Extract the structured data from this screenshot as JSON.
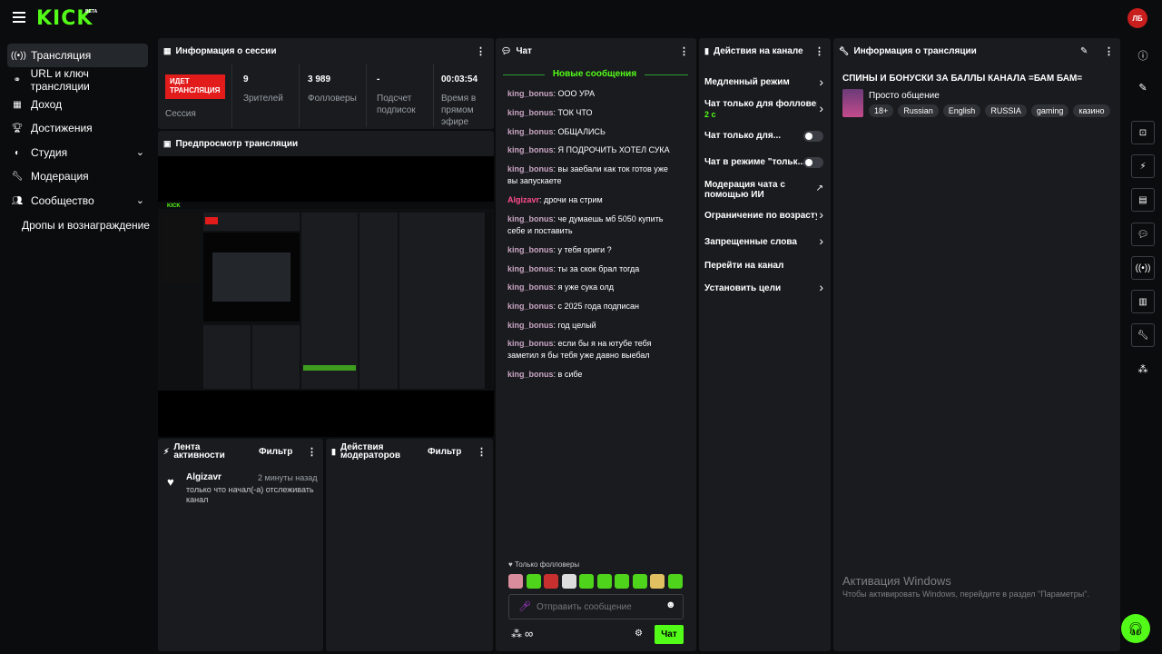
{
  "topbar": {
    "logo": "KICK",
    "beta": "BETA",
    "avatar": "ЛБ"
  },
  "sidebar": {
    "items": [
      {
        "label": "Трансляция",
        "icon": "broadcast-icon"
      },
      {
        "label": "URL и ключ трансляции",
        "icon": "link-icon"
      },
      {
        "label": "Доход",
        "icon": "chart-icon"
      },
      {
        "label": "Достижения",
        "icon": "trophy-icon"
      },
      {
        "label": "Студия",
        "icon": "palette-icon"
      },
      {
        "label": "Модерация",
        "icon": "wrench-icon"
      },
      {
        "label": "Сообщество",
        "icon": "people-icon"
      },
      {
        "label": "Дропы и вознаграждение",
        "icon": ""
      }
    ]
  },
  "session": {
    "title": "Информация о сессии",
    "live_badge": "ИДЕТ ТРАНСЛЯЦИЯ",
    "session_label": "Сессия",
    "stats": [
      {
        "value": "9",
        "label": "Зрителей"
      },
      {
        "value": "3 989",
        "label": "Фолловеры"
      },
      {
        "value": "-",
        "label": "Подсчет подписок"
      },
      {
        "value": "00:03:54",
        "label": "Время в прямом эфире"
      }
    ]
  },
  "preview": {
    "title": "Предпросмотр трансляции"
  },
  "activity": {
    "title": "Лента активности",
    "filter": "Фильтр",
    "items": [
      {
        "user": "Algizavr",
        "time": "2 минуты назад",
        "text": "только что начал(-а) отслеживать канал"
      }
    ]
  },
  "modactions": {
    "title": "Действия модераторов",
    "filter": "Фильтр"
  },
  "chat": {
    "title": "Чат",
    "new_messages": "Новые сообщения",
    "messages": [
      {
        "user": "king_bonus",
        "text": "ООО УРА"
      },
      {
        "user": "king_bonus",
        "text": "ТОК ЧТО"
      },
      {
        "user": "king_bonus",
        "text": "ОБЩАЛИСЬ"
      },
      {
        "user": "king_bonus",
        "text": "Я ПОДРОЧИТЬ ХОТЕЛ СУКА"
      },
      {
        "user": "king_bonus",
        "text": "вы заебали как ток готов уже вы запускаете"
      },
      {
        "user": "Algizavr",
        "text": "дрочи на стрим"
      },
      {
        "user": "king_bonus",
        "text": "че думаешь мб 5050 купить себе и поставить"
      },
      {
        "user": "king_bonus",
        "text": "у тебя ориги ?"
      },
      {
        "user": "king_bonus",
        "text": "ты за скок брал тогда"
      },
      {
        "user": "king_bonus",
        "text": "я уже сука олд"
      },
      {
        "user": "king_bonus",
        "text": "с 2025 года подписан"
      },
      {
        "user": "king_bonus",
        "text": "год целый"
      },
      {
        "user": "king_bonus",
        "text": "если бы я на ютубе тебя заметил я бы тебя уже давно выебал"
      },
      {
        "user": "king_bonus",
        "text": "в сибе"
      }
    ],
    "followers_only": "Только фолловеры",
    "placeholder": "Отправить сообщение",
    "send": "Чат"
  },
  "channel_actions": {
    "title": "Действия на канале",
    "items": [
      {
        "label": "Медленный режим"
      },
      {
        "label": "Чат только для фолловер",
        "sub": "2 с"
      },
      {
        "label": "Чат только для..."
      },
      {
        "label": "Чат в режиме \"тольк..."
      },
      {
        "label": "Модерация чата с помощью ИИ"
      },
      {
        "label": "Ограничение по возрасту"
      },
      {
        "label": "Запрещенные слова"
      },
      {
        "label": "Перейти на канал"
      },
      {
        "label": "Установить цели"
      }
    ]
  },
  "stream_info": {
    "title": "Информация о трансляции",
    "stream_title": "СПИНЫ И БОНУСКИ ЗА БАЛЛЫ КАНАЛА =БАМ БАМ=",
    "category": "Просто общение",
    "tags": [
      "18+",
      "Russian",
      "English",
      "RUSSIA",
      "gaming",
      "казино"
    ]
  },
  "windows": {
    "title": "Активация Windows",
    "text": "Чтобы активировать Windows, перейдите в раздел \"Параметры\"."
  }
}
